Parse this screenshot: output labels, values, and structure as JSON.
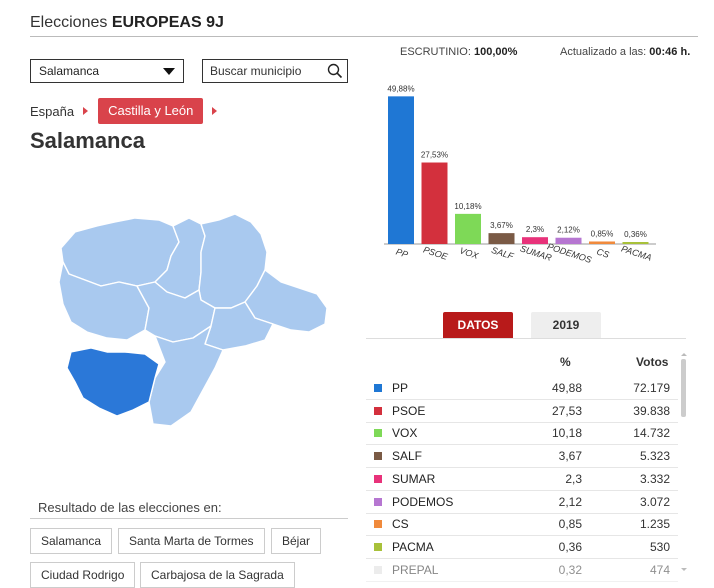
{
  "header": {
    "prefix": "Elecciones",
    "title": "EUROPEAS 9J"
  },
  "controls": {
    "select_value": "Salamanca",
    "search_placeholder": "Buscar municipio"
  },
  "breadcrumb": {
    "root": "España",
    "active": "Castilla y León"
  },
  "municipality": "Salamanca",
  "status": {
    "scrutiny_label": "ESCRUTINIO:",
    "scrutiny_value": "100,00%",
    "updated_label": "Actualizado a las:",
    "updated_value": "00:46 h."
  },
  "tabs": {
    "datos": "DATOS",
    "year": "2019"
  },
  "table": {
    "col_pct": "%",
    "col_votes": "Votos",
    "rows": [
      {
        "party": "PP",
        "pct": "49,88",
        "votes": "72.179",
        "color": "#1f77d4"
      },
      {
        "party": "PSOE",
        "pct": "27,53",
        "votes": "39.838",
        "color": "#d3303d"
      },
      {
        "party": "VOX",
        "pct": "10,18",
        "votes": "14.732",
        "color": "#7ed957"
      },
      {
        "party": "SALF",
        "pct": "3,67",
        "votes": "5.323",
        "color": "#7a5a45"
      },
      {
        "party": "SUMAR",
        "pct": "2,3",
        "votes": "3.332",
        "color": "#e8327a"
      },
      {
        "party": "PODEMOS",
        "pct": "2,12",
        "votes": "3.072",
        "color": "#b676d1"
      },
      {
        "party": "CS",
        "pct": "0,85",
        "votes": "1.235",
        "color": "#f08a3c"
      },
      {
        "party": "PACMA",
        "pct": "0,36",
        "votes": "530",
        "color": "#a8c13a"
      },
      {
        "party": "PREPAL",
        "pct": "0,32",
        "votes": "474",
        "color": "#dddddd"
      }
    ]
  },
  "chart_data": {
    "type": "bar",
    "categories": [
      "PP",
      "PSOE",
      "VOX",
      "SALF",
      "SUMAR",
      "PODEMOS",
      "CS",
      "PACMA"
    ],
    "values": [
      49.88,
      27.53,
      10.18,
      3.67,
      2.3,
      2.12,
      0.85,
      0.36
    ],
    "labels": [
      "49,88%",
      "27,53%",
      "10,18%",
      "3,67%",
      "2,3%",
      "2,12%",
      "0,85%",
      "0,36%"
    ],
    "colors": [
      "#1f77d4",
      "#d3303d",
      "#7ed957",
      "#7a5a45",
      "#e8327a",
      "#b676d1",
      "#f08a3c",
      "#a8c13a"
    ],
    "ylim": [
      0,
      50
    ]
  },
  "results": {
    "label": "Resultado de las elecciones en:",
    "buttons": [
      "Salamanca",
      "Santa Marta de Tormes",
      "Béjar",
      "Ciudad Rodrigo",
      "Carbajosa de la Sagrada"
    ]
  }
}
